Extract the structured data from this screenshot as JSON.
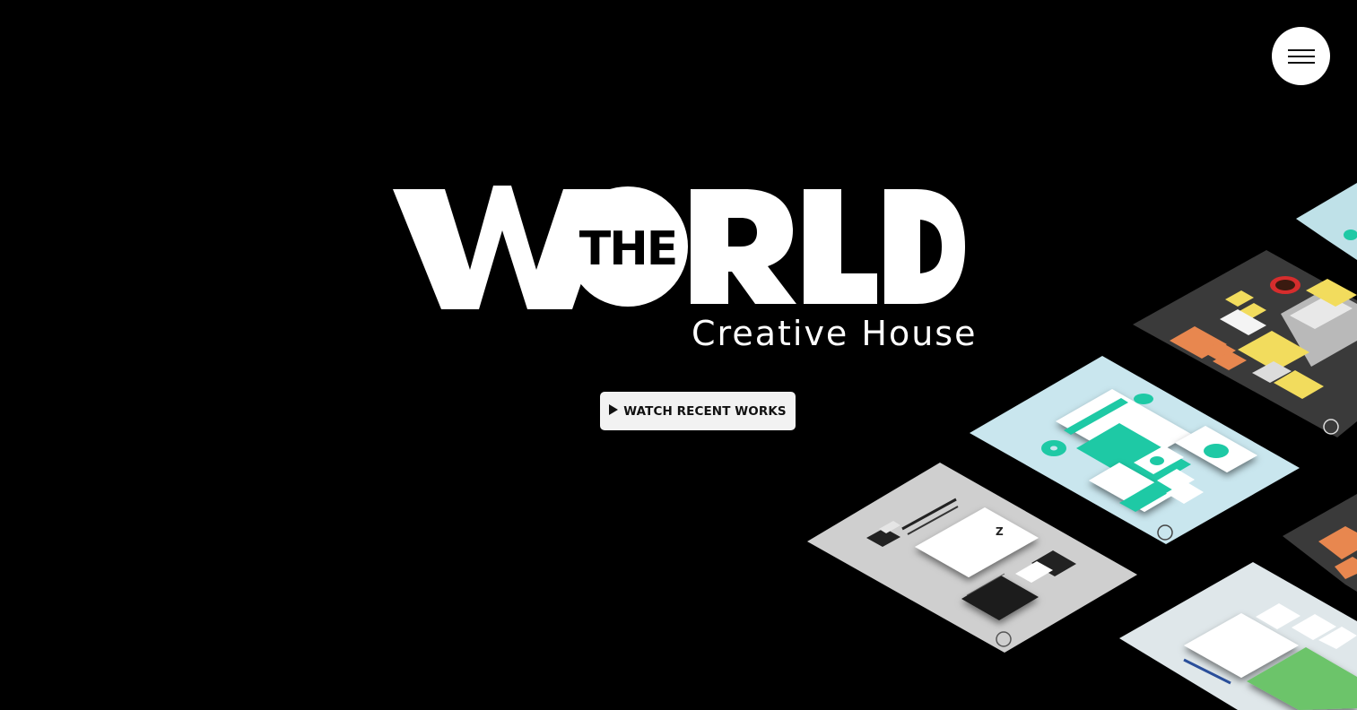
{
  "logo": {
    "text_the": "THE",
    "text_world": "WORLD",
    "tagline": "Creative House"
  },
  "cta": {
    "label": "WATCH RECENT WORKS",
    "icon": "play-icon"
  },
  "menu": {
    "icon": "hamburger-menu-icon"
  },
  "colors": {
    "background": "#000000",
    "foreground": "#ffffff",
    "button_bg": "#f2f2f2",
    "accent_teal": "#1ec9a5",
    "accent_yellow": "#f2dc5d",
    "accent_orange": "#e8874f",
    "accent_green": "#6cc46a"
  },
  "showcase": {
    "items": [
      "mockup-light-blue-top",
      "mockup-dark-stationery",
      "mockup-teal-stationery",
      "mockup-gray-stationery",
      "mockup-dark-orange",
      "mockup-green-stationery"
    ]
  }
}
